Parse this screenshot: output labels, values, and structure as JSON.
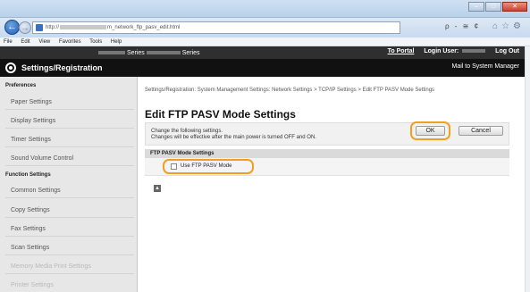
{
  "browser": {
    "url_prefix": "http://",
    "url_suffix": "m_network_ftp_pasv_edit.html",
    "address_tools": "ρ - ≅ ¢",
    "menu": [
      "File",
      "Edit",
      "View",
      "Favorites",
      "Tools",
      "Help"
    ]
  },
  "header": {
    "model_name": "Series",
    "portal_link": "To Portal",
    "login_user_label": "Login User:",
    "logout": "Log Out",
    "app_title": "Settings/Registration",
    "mail_button": "Mail to System Manager"
  },
  "sidebar": {
    "preferences_title": "Preferences",
    "preferences": [
      "Paper Settings",
      "Display Settings",
      "Timer Settings",
      "Sound Volume Control"
    ],
    "function_title": "Function Settings",
    "functions": [
      "Common Settings",
      "Copy Settings",
      "Fax Settings",
      "Scan Settings",
      "Memory Media Print Settings",
      "Printer Settings"
    ]
  },
  "main": {
    "breadcrumb": "Settings/Registration: System Management Settings: Network Settings > TCP/IP Settings > Edit FTP PASV Mode Settings",
    "title": "Edit FTP PASV Mode Settings",
    "info_line1": "Change the following settings.",
    "info_line2": "Changes will be effective after the main power is turned OFF and ON.",
    "ok_label": "OK",
    "cancel_label": "Cancel",
    "section_title": "FTP PASV Mode Settings",
    "checkbox_label": "Use FTP PASV Mode",
    "checkbox_checked": false
  },
  "colors": {
    "highlight": "#f0a020",
    "header_dark": "#111111"
  }
}
